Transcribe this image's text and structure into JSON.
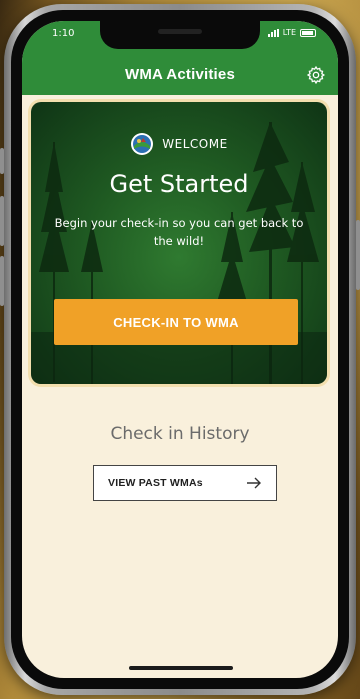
{
  "status_bar": {
    "time": "1:10",
    "network": "LTE"
  },
  "app_bar": {
    "title": "WMA Activities",
    "settings_icon": "gear-icon"
  },
  "hero": {
    "welcome_label": "WELCOME",
    "title": "Get Started",
    "subtitle": "Begin your check-in so you can get back to the wild!",
    "cta_label": "CHECK-IN TO WMA"
  },
  "history": {
    "title": "Check in History",
    "button_label": "VIEW PAST WMAs"
  },
  "colors": {
    "header_green": "#2f8c39",
    "accent_orange": "#f0a127",
    "screen_bg": "#f9f0dc",
    "card_border": "#f3dfae"
  }
}
